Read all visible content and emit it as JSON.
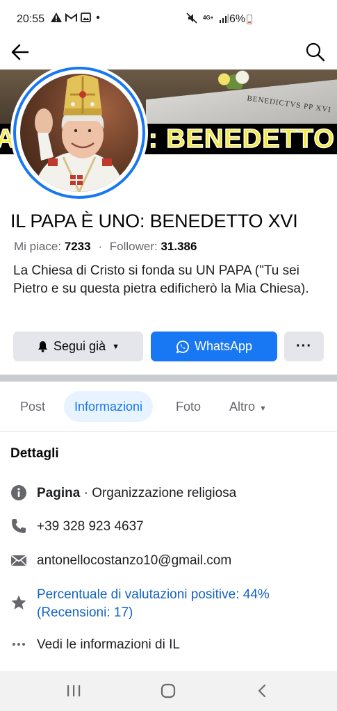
{
  "status_bar": {
    "time": "20:55",
    "battery": "6%",
    "network": "4G+",
    "icons": [
      "alert-icon",
      "gmail-icon",
      "gallery-icon",
      "dot-icon",
      "mute-icon",
      "signal-icon",
      "battery-icon"
    ]
  },
  "nav": {
    "back_icon": "arrow-left-icon",
    "search_icon": "search-icon"
  },
  "cover": {
    "overlay_text": "IL PAPA È UNO: BENEDETTO XVI",
    "visible_fragment_left": "A",
    "visible_fragment_right": ": BENEDETTO",
    "book_text": "BENEDICTVS PP XVI"
  },
  "page": {
    "name": "IL PAPA È UNO: BENEDETTO XVI",
    "likes_label": "Mi piace:",
    "likes_value": "7233",
    "separator": "·",
    "followers_label": "Follower:",
    "followers_value": "31.386",
    "bio": "La Chiesa di Cristo si fonda su UN PAPA (\"Tu sei Pietro e su questa pietra edificherò la Mia Chiesa)."
  },
  "actions": {
    "follow_label": "Segui già",
    "whatsapp_label": "WhatsApp",
    "more_label": "···"
  },
  "tabs": [
    {
      "label": "Post",
      "active": false
    },
    {
      "label": "Informazioni",
      "active": true
    },
    {
      "label": "Foto",
      "active": false
    },
    {
      "label": "Altro",
      "active": false
    }
  ],
  "details": {
    "title": "Dettagli",
    "category_bold": "Pagina",
    "category_rest": " · Organizzazione religiosa",
    "phone": "+39 328 923 4637",
    "email": "antonellocostanzo10@gmail.com",
    "rating": "Percentuale di valutazioni positive: 44% (Recensioni: 17)",
    "more_info": "Vedi le informazioni di IL"
  },
  "colors": {
    "accent": "#1877f2",
    "link": "#1463c4",
    "secondary_text": "#65676b",
    "button_gray": "#e4e6eb",
    "cover_text_yellow": "#f4e83a"
  }
}
